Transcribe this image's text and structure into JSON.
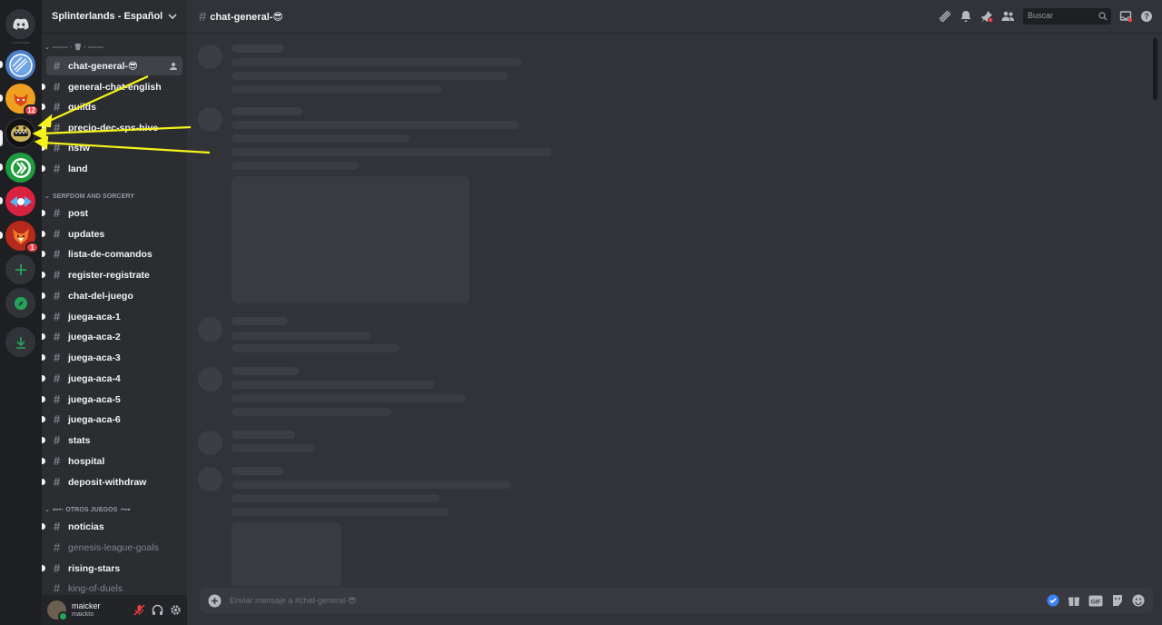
{
  "server": {
    "name": "Splinterlands - Español"
  },
  "channel_header": {
    "name": "chat-general-😎"
  },
  "search": {
    "placeholder": "Buscar"
  },
  "rail": {
    "badges": {
      "server2": "12",
      "server6": "1"
    }
  },
  "categories": [
    {
      "label": "------- · 🗑 · -------"
    },
    {
      "label": "SERFDOM AND SORCERY"
    },
    {
      "label": "⊷•◦ OTROS JUEGOS ◦•⊶"
    }
  ],
  "channels": [
    {
      "name": "chat-general-😎"
    },
    {
      "name": "general-chat-english"
    },
    {
      "name": "guilds"
    },
    {
      "name": "precio-dec-sps-hive"
    },
    {
      "name": "nsfw"
    },
    {
      "name": "land"
    },
    {
      "name": "post"
    },
    {
      "name": "updates"
    },
    {
      "name": "lista-de-comandos"
    },
    {
      "name": "register-registrate"
    },
    {
      "name": "chat-del-juego"
    },
    {
      "name": "juega-aca-1"
    },
    {
      "name": "juega-aca-2"
    },
    {
      "name": "juega-aca-3"
    },
    {
      "name": "juega-aca-4"
    },
    {
      "name": "juega-aca-5"
    },
    {
      "name": "juega-aca-6"
    },
    {
      "name": "stats"
    },
    {
      "name": "hospital"
    },
    {
      "name": "deposit-withdraw"
    },
    {
      "name": "noticias"
    },
    {
      "name": "genesis-league-goals"
    },
    {
      "name": "rising-stars"
    },
    {
      "name": "king-of-duels"
    }
  ],
  "user": {
    "name": "maicker",
    "tag": "maickto"
  },
  "composer": {
    "placeholder": "Enviar mensaje a #chat-general-😎"
  },
  "colors": {
    "accent": "#5865f2",
    "annotation_arrow": "#f5f31a",
    "online": "#23a559",
    "mention": "#f23f43"
  }
}
